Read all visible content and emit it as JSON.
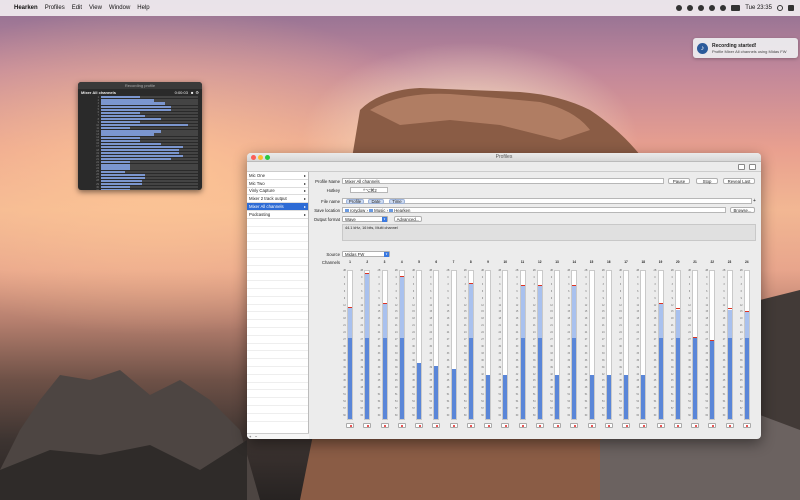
{
  "menubar": {
    "apple": "",
    "app_name": "Hearken",
    "menus": [
      "Profiles",
      "Edit",
      "View",
      "Window",
      "Help"
    ],
    "clock": "Tue 23:35"
  },
  "notification": {
    "title": "Recording started!",
    "body": "Profile Mixer All channels using Midas FW"
  },
  "recording_window": {
    "title": "Recording profile",
    "profile": "Mixer All channels",
    "time": "0:00:03",
    "track_levels": [
      0.4,
      0.55,
      0.66,
      0.72,
      0.72,
      0.4,
      0.45,
      0.62,
      0.4,
      0.9,
      0.3,
      0.62,
      0.55,
      0.4,
      0.4,
      0.62,
      0.85,
      0.8,
      0.8,
      0.85,
      0.72,
      0.3,
      0.3,
      0.3,
      0.25,
      0.45,
      0.45,
      0.42,
      0.42,
      0.3,
      0.3,
      0.4,
      0.4,
      0.55,
      0.55,
      0.3
    ]
  },
  "main_window": {
    "title": "Profiles",
    "sidebar": {
      "items": [
        {
          "label": "Mic One",
          "selected": false
        },
        {
          "label": "Mic Two",
          "selected": false
        },
        {
          "label": "Vinly Capture",
          "selected": false
        },
        {
          "label": "Mixer 2 track output",
          "selected": false
        },
        {
          "label": "Mixer All channels",
          "selected": true
        },
        {
          "label": "Podcasting",
          "selected": false
        }
      ]
    },
    "form": {
      "profile_name_label": "Profile Name",
      "profile_name_value": "Mixer All channels",
      "pause_label": "Pause",
      "stop_label": "Stop",
      "reveal_label": "Reveal Last",
      "hotkey_label": "Hotkey",
      "hotkey_value": "^⌥⌘2",
      "file_name_label": "File name",
      "file_tokens": [
        "Profile",
        "Date",
        "Time"
      ],
      "save_location_label": "Save location",
      "save_path": [
        "rorydow",
        "Music",
        "Hearken"
      ],
      "browse_label": "Browse...",
      "output_format_label": "Output format",
      "output_format_value": "Wave",
      "advanced_label": "Advanced...",
      "format_info": "44.1 kHz, 16 bits, Multi channel",
      "source_label": "Source",
      "source_value": "Midas FW",
      "channels_label": "Channels"
    },
    "channels": [
      {
        "num": "1",
        "level": 0.7,
        "peak": 0.75
      },
      {
        "num": "2",
        "level": 0.7,
        "peak": 0.98
      },
      {
        "num": "3",
        "level": 0.7,
        "peak": 0.78
      },
      {
        "num": "4",
        "level": 0.7,
        "peak": 0.96
      },
      {
        "num": "5",
        "level": 0.38,
        "peak": 0.38
      },
      {
        "num": "6",
        "level": 0.36,
        "peak": 0.36
      },
      {
        "num": "7",
        "level": 0.34,
        "peak": 0.34
      },
      {
        "num": "8",
        "level": 0.7,
        "peak": 0.91
      },
      {
        "num": "9",
        "level": 0.3,
        "peak": 0.3
      },
      {
        "num": "10",
        "level": 0.3,
        "peak": 0.3
      },
      {
        "num": "11",
        "level": 0.7,
        "peak": 0.9
      },
      {
        "num": "12",
        "level": 0.7,
        "peak": 0.9
      },
      {
        "num": "13",
        "level": 0.3,
        "peak": 0.3
      },
      {
        "num": "14",
        "level": 0.7,
        "peak": 0.9
      },
      {
        "num": "15",
        "level": 0.3,
        "peak": 0.3
      },
      {
        "num": "16",
        "level": 0.3,
        "peak": 0.3
      },
      {
        "num": "17",
        "level": 0.3,
        "peak": 0.3
      },
      {
        "num": "18",
        "level": 0.3,
        "peak": 0.3
      },
      {
        "num": "19",
        "level": 0.7,
        "peak": 0.78
      },
      {
        "num": "20",
        "level": 0.7,
        "peak": 0.74
      },
      {
        "num": "21",
        "level": 0.55,
        "peak": 0.55
      },
      {
        "num": "22",
        "level": 0.53,
        "peak": 0.53
      },
      {
        "num": "23",
        "level": 0.7,
        "peak": 0.74
      },
      {
        "num": "24",
        "level": 0.7,
        "peak": 0.72
      }
    ],
    "meter_scale": [
      "dB",
      "0",
      "3",
      "6",
      "9",
      "12",
      "15",
      "18",
      "21",
      "24",
      "27",
      "30",
      "33",
      "36",
      "39",
      "42",
      "45",
      "48",
      "51",
      "54",
      "57",
      "60"
    ]
  }
}
